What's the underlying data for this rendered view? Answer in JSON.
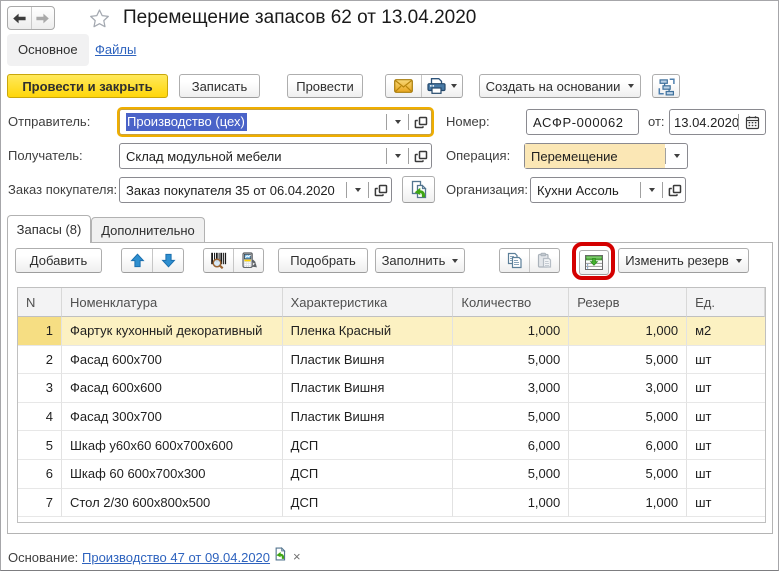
{
  "window": {
    "title": "Перемещение запасов 62 от 13.04.2020"
  },
  "nav_tabs": {
    "main": "Основное",
    "files": "Файлы"
  },
  "toolbar": {
    "post_and_close": "Провести и закрыть",
    "save": "Записать",
    "post": "Провести",
    "create_based_on": "Создать на основании"
  },
  "fields": {
    "sender": {
      "label": "Отправитель:",
      "value": "Производство (цех)"
    },
    "receiver": {
      "label": "Получатель:",
      "value": "Склад модульной мебели"
    },
    "customer_order": {
      "label": "Заказ покупателя:",
      "value": "Заказ покупателя 35 от 06.04.2020"
    },
    "number": {
      "label": "Номер:",
      "value": "АСФР-000062"
    },
    "date": {
      "label": "от:",
      "value": "13.04.2020"
    },
    "operation": {
      "label": "Операция:",
      "value": "Перемещение"
    },
    "organization": {
      "label": "Организация:",
      "value": "Кухни Ассоль"
    }
  },
  "item_tabs": {
    "inventory": "Запасы (8)",
    "additional": "Дополнительно"
  },
  "table_toolbar": {
    "add": "Добавить",
    "pick": "Подобрать",
    "fill": "Заполнить",
    "change_reserve": "Изменить резерв"
  },
  "table": {
    "columns": [
      "N",
      "Номенклатура",
      "Характеристика",
      "Количество",
      "Резерв",
      "Ед."
    ],
    "rows": [
      {
        "n": "1",
        "name": "Фартук кухонный декоративный",
        "characteristic": "Пленка Красный",
        "quantity": "1,000",
        "reserve": "1,000",
        "unit": "м2",
        "selected": true
      },
      {
        "n": "2",
        "name": "Фасад 600х700",
        "characteristic": "Пластик Вишня",
        "quantity": "5,000",
        "reserve": "5,000",
        "unit": "шт",
        "selected": false
      },
      {
        "n": "3",
        "name": "Фасад 600х600",
        "characteristic": "Пластик Вишня",
        "quantity": "3,000",
        "reserve": "3,000",
        "unit": "шт",
        "selected": false
      },
      {
        "n": "4",
        "name": "Фасад 300х700",
        "characteristic": "Пластик Вишня",
        "quantity": "5,000",
        "reserve": "5,000",
        "unit": "шт",
        "selected": false
      },
      {
        "n": "5",
        "name": "Шкаф у60х60 600х700х600",
        "characteristic": "ДСП",
        "quantity": "6,000",
        "reserve": "6,000",
        "unit": "шт",
        "selected": false
      },
      {
        "n": "6",
        "name": "Шкаф 60 600х700х300",
        "characteristic": "ДСП",
        "quantity": "5,000",
        "reserve": "5,000",
        "unit": "шт",
        "selected": false
      },
      {
        "n": "7",
        "name": "Стол 2/30 600х800х500",
        "characteristic": "ДСП",
        "quantity": "1,000",
        "reserve": "1,000",
        "unit": "шт",
        "selected": false
      }
    ]
  },
  "footer": {
    "label": "Основание:",
    "link": "Производство 47 от 09.04.2020",
    "clear": "×"
  },
  "colors": {
    "focus_ring": "#efae00",
    "selection": "#4a63c8",
    "selected_row": "#fcf1c2",
    "selected_row_number_cell": "#f3d95f",
    "operation_field_bg": "#fbe7b5",
    "annotation_ring": "#d40000",
    "link": "#2e63be",
    "primary_button": "#ffd60a"
  }
}
